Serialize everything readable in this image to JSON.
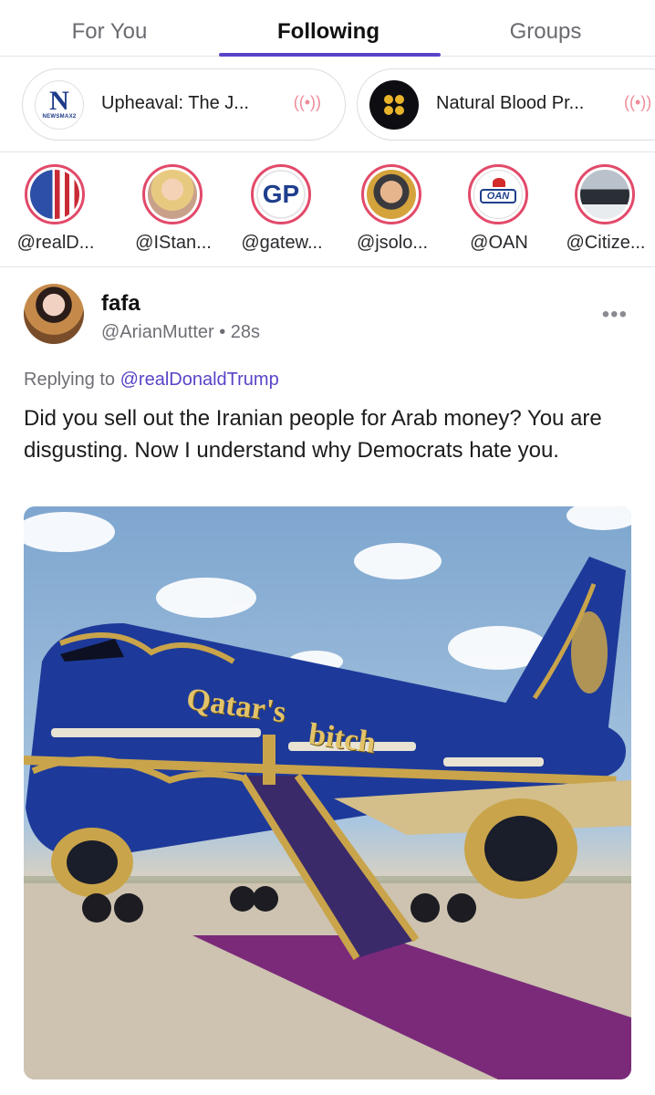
{
  "tabs": [
    "For You",
    "Following",
    "Groups"
  ],
  "live_pills": [
    {
      "title": "Upheaval: The J...",
      "logo": "newsmax-logo",
      "logo_text": "N",
      "logo_sub": "NEWSMAX2",
      "live_icon": "((•))"
    },
    {
      "title": "Natural Blood Pr...",
      "logo": "four-dots-logo",
      "live_icon": "((•))"
    }
  ],
  "stories": [
    {
      "handle": "@realD..."
    },
    {
      "handle": "@IStan..."
    },
    {
      "handle": "@gatew...",
      "logo_text": "GP"
    },
    {
      "handle": "@jsolo..."
    },
    {
      "handle": "@OAN",
      "logo_text": "OAN"
    },
    {
      "handle": "@Citize..."
    }
  ],
  "post": {
    "name": "fafa",
    "handle_time": "@ArianMutter • 28s",
    "more": "•••",
    "replying_prefix": "Replying to ",
    "replying_to": "@realDonaldTrump",
    "text": "Did you sell out the Iranian people for Arab money? You are disgusting. Now I understand why Democrats hate you.",
    "image": {
      "text_line1": "Qatar's",
      "text_line2": "bitch"
    }
  },
  "colors": {
    "accent": "#5a43c8",
    "story_ring": "#e24a6a",
    "plane_blue": "#1d3a9a",
    "gold": "#c9a44a",
    "carpet": "#7b2a7a"
  }
}
